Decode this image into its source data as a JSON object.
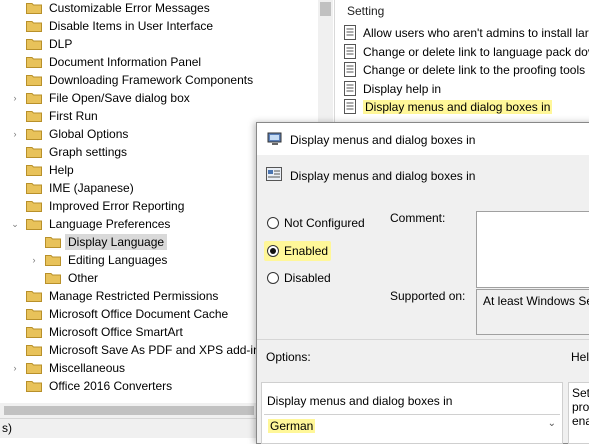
{
  "tree": {
    "items": [
      {
        "label": "Customizable Error Messages",
        "indent": 0,
        "chevron": ""
      },
      {
        "label": "Disable Items in User Interface",
        "indent": 0,
        "chevron": ""
      },
      {
        "label": "DLP",
        "indent": 0,
        "chevron": ""
      },
      {
        "label": "Document Information Panel",
        "indent": 0,
        "chevron": ""
      },
      {
        "label": "Downloading Framework Components",
        "indent": 0,
        "chevron": ""
      },
      {
        "label": "File Open/Save dialog box",
        "indent": 0,
        "chevron": "›"
      },
      {
        "label": "First Run",
        "indent": 0,
        "chevron": ""
      },
      {
        "label": "Global Options",
        "indent": 0,
        "chevron": "›"
      },
      {
        "label": "Graph settings",
        "indent": 0,
        "chevron": ""
      },
      {
        "label": "Help",
        "indent": 0,
        "chevron": ""
      },
      {
        "label": "IME (Japanese)",
        "indent": 0,
        "chevron": ""
      },
      {
        "label": "Improved Error Reporting",
        "indent": 0,
        "chevron": ""
      },
      {
        "label": "Language Preferences",
        "indent": 0,
        "chevron": "⌄"
      },
      {
        "label": "Display Language",
        "indent": 1,
        "chevron": "",
        "selected": true
      },
      {
        "label": "Editing Languages",
        "indent": 1,
        "chevron": "›"
      },
      {
        "label": "Other",
        "indent": 1,
        "chevron": ""
      },
      {
        "label": "Manage Restricted Permissions",
        "indent": 0,
        "chevron": ""
      },
      {
        "label": "Microsoft Office Document Cache",
        "indent": 0,
        "chevron": ""
      },
      {
        "label": "Microsoft Office SmartArt",
        "indent": 0,
        "chevron": ""
      },
      {
        "label": "Microsoft Save As PDF and XPS add-ins",
        "indent": 0,
        "chevron": ""
      },
      {
        "label": "Miscellaneous",
        "indent": 0,
        "chevron": "›"
      },
      {
        "label": "Office 2016 Converters",
        "indent": 0,
        "chevron": ""
      }
    ],
    "status_text": "s)"
  },
  "settings": {
    "header": "Setting",
    "items": [
      {
        "label": "Allow users who aren't admins to install lar"
      },
      {
        "label": "Change or delete link to language pack dov"
      },
      {
        "label": "Change or delete link to the proofing tools"
      },
      {
        "label": "Display help in"
      },
      {
        "label": "Display menus and dialog boxes in",
        "selected": true
      }
    ]
  },
  "dialog": {
    "title": "Display menus and dialog boxes in",
    "policy_name": "Display menus and dialog boxes in",
    "radios": {
      "not_configured": "Not Configured",
      "enabled": "Enabled",
      "disabled": "Disabled",
      "selected": "enabled"
    },
    "comment_label": "Comment:",
    "supported_label": "Supported on:",
    "supported_value": "At least Windows Se",
    "options_label": "Options:",
    "help_label": "Hel",
    "option_field_label": "Display menus and dialog boxes in",
    "language_value": "German",
    "help_text": [
      "Set",
      "pro",
      "ena"
    ]
  },
  "colors": {
    "highlight": "#fff799",
    "tree_selected": "#d9d9d9",
    "folder": "#e8c25a"
  }
}
